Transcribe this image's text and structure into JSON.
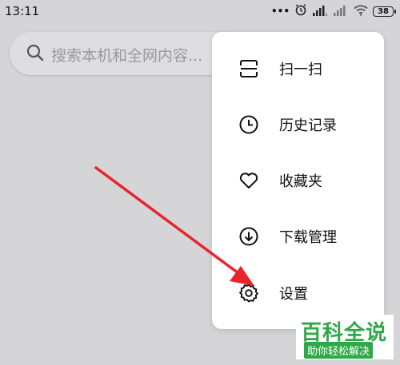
{
  "status_bar": {
    "time": "13:11",
    "dots": "•••",
    "battery": "38"
  },
  "search": {
    "placeholder": "搜索本机和全网内容..."
  },
  "menu": {
    "items": [
      {
        "label": "扫一扫",
        "icon": "scan-icon"
      },
      {
        "label": "历史记录",
        "icon": "clock-icon"
      },
      {
        "label": "收藏夹",
        "icon": "heart-icon"
      },
      {
        "label": "下载管理",
        "icon": "download-icon"
      },
      {
        "label": "设置",
        "icon": "gear-icon"
      }
    ]
  },
  "watermark": {
    "title": "百科全说",
    "subtitle": "助你轻松解决"
  },
  "colors": {
    "background": "#d5d5d7",
    "menu_bg": "#ffffff",
    "arrow": "#e8242c",
    "watermark_green": "#2fa84a"
  }
}
